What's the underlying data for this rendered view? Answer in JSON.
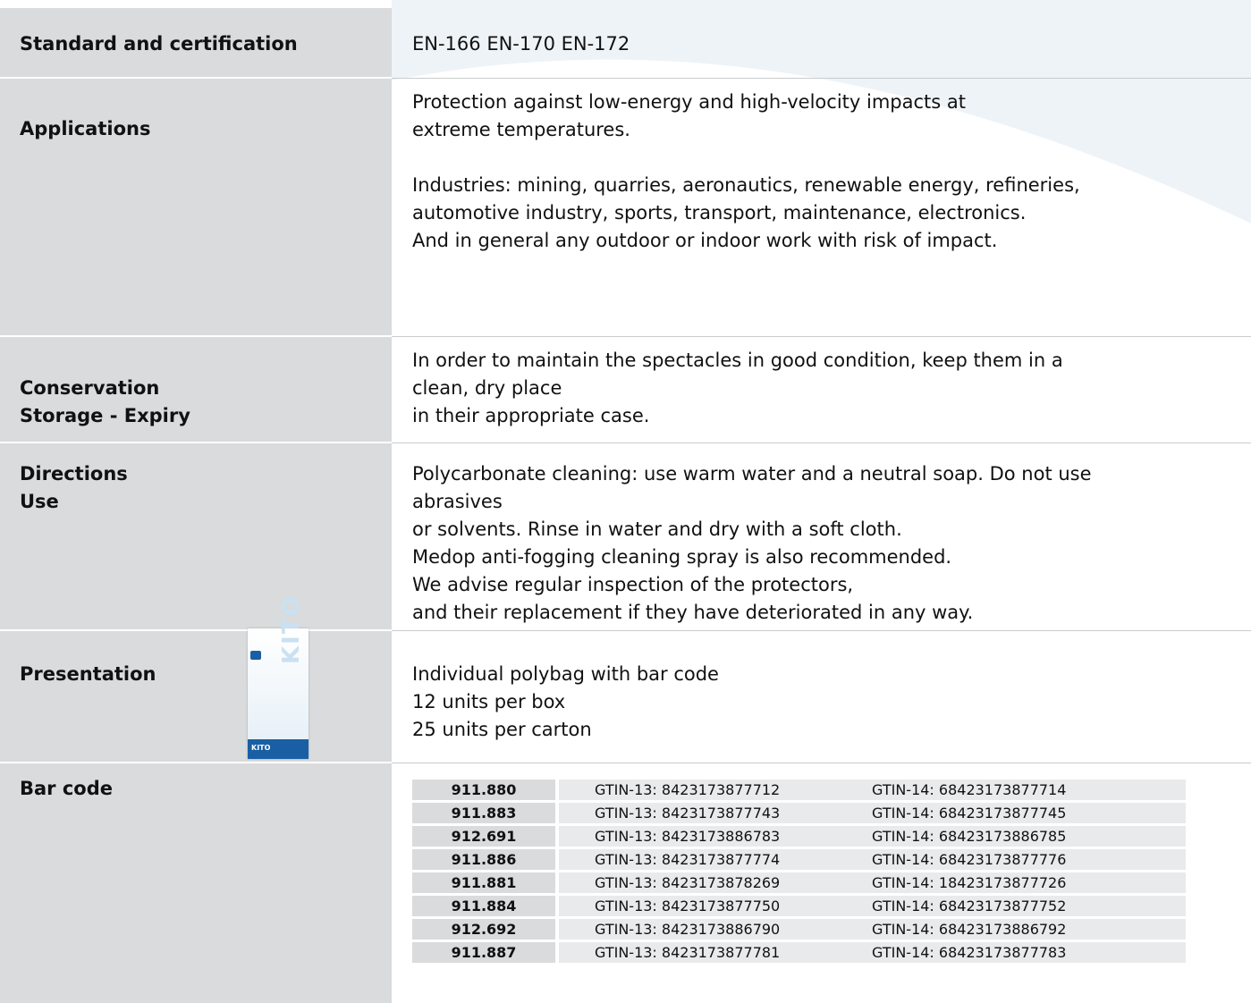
{
  "rows": {
    "standard": {
      "label": "Standard and certification",
      "value": "EN-166  EN-170  EN-172"
    },
    "applications": {
      "label": "Applications",
      "lines": [
        "Protection against low-energy and high-velocity impacts at",
        "extreme temperatures.",
        "Industries: mining, quarries, aeronautics, renewable energy, refineries,",
        "automotive industry, sports, transport, maintenance, electronics.",
        "And in general any outdoor or indoor work with risk of impact."
      ]
    },
    "conservation": {
      "label_1": "Conservation",
      "label_2": "Storage - Expiry",
      "lines": [
        "In order to maintain the spectacles in good condition, keep them in a",
        "clean, dry place",
        "in their appropriate case."
      ]
    },
    "directions": {
      "label_1": "Directions",
      "label_2": "Use",
      "lines": [
        "Polycarbonate cleaning: use warm water and a neutral soap. Do not use",
        "abrasives",
        "or solvents. Rinse in water and dry with a soft cloth.",
        "Medop anti-fogging cleaning spray is also recommended.",
        "We advise regular inspection of the protectors,",
        "and their replacement if they have deteriorated in any way."
      ]
    },
    "presentation": {
      "label": "Presentation",
      "package_vertical_text": "KITO",
      "package_band_text": "KITO",
      "lines": [
        "Individual polybag with bar code",
        "12 units per box",
        "25 units per carton"
      ]
    },
    "barcode": {
      "label": "Bar code",
      "entries": [
        {
          "code": "911.880",
          "gtin13": "GTIN-13: 8423173877712",
          "gtin14": "GTIN-14:  68423173877714"
        },
        {
          "code": "911.883",
          "gtin13": "GTIN-13: 8423173877743",
          "gtin14": "GTIN-14:  68423173877745"
        },
        {
          "code": "912.691",
          "gtin13": "GTIN-13: 8423173886783",
          "gtin14": "GTIN-14:  68423173886785"
        },
        {
          "code": "911.886",
          "gtin13": "GTIN-13: 8423173877774",
          "gtin14": "GTIN-14:  68423173877776"
        },
        {
          "code": "911.881",
          "gtin13": "GTIN-13: 8423173878269",
          "gtin14": "GTIN-14:  18423173877726"
        },
        {
          "code": "911.884",
          "gtin13": "GTIN-13: 8423173877750",
          "gtin14": "GTIN-14:  68423173877752"
        },
        {
          "code": "912.692",
          "gtin13": "GTIN-13: 8423173886790",
          "gtin14": "GTIN-14:  68423173886792"
        },
        {
          "code": "911.887",
          "gtin13": "GTIN-13: 8423173877781",
          "gtin14": "GTIN-14:  68423173877783"
        }
      ]
    }
  },
  "colors": {
    "label_column": "#d9dbdc",
    "background_shape": "#eef3f8",
    "package_blue": "#1a5fa3"
  }
}
